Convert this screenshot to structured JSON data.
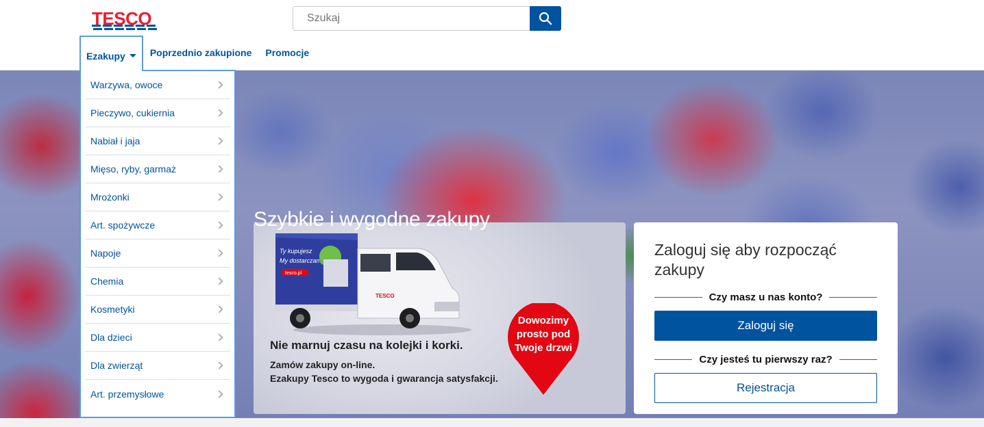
{
  "brand": {
    "name": "TESCO",
    "color": "#ee1c2e",
    "stripe_color": "#00539f"
  },
  "search": {
    "placeholder": "Szukaj",
    "icon": "search-icon"
  },
  "nav": {
    "items": [
      {
        "label": "Ezakupy"
      },
      {
        "label": "Poprzednio zakupione"
      },
      {
        "label": "Promocje"
      }
    ]
  },
  "categories": [
    {
      "label": "Warzywa, owoce"
    },
    {
      "label": "Pieczywo, cukiernia"
    },
    {
      "label": "Nabiał i jaja"
    },
    {
      "label": "Mięso, ryby, garmaż"
    },
    {
      "label": "Mrożonki"
    },
    {
      "label": "Art. spożywcze"
    },
    {
      "label": "Napoje"
    },
    {
      "label": "Chemia"
    },
    {
      "label": "Kosmetyki"
    },
    {
      "label": "Dla dzieci"
    },
    {
      "label": "Dla zwierząt"
    },
    {
      "label": "Art. przemysłowe"
    }
  ],
  "hero": {
    "title": "Szybkie i wygodne zakupy"
  },
  "promo": {
    "truck_text_1": "Ty kupujesz",
    "truck_text_2": "My dostarczamy",
    "truck_badge": "tesco.pl",
    "truck_brand": "TESCO",
    "headline": "Nie marnuj czasu na kolejki i korki.",
    "line1": "Zamów zakupy on-line.",
    "line2": "Ezakupy Tesco to wygoda i gwarancja satysfakcji.",
    "pin_text": "Dowozimy prosto pod Twoje drzwi"
  },
  "login": {
    "title": "Zaloguj się aby rozpocząć zakupy",
    "has_account": "Czy masz u nas konto?",
    "login_button": "Zaloguj się",
    "first_time": "Czy jesteś tu pierwszy raz?",
    "register_button": "Rejestracja"
  },
  "colors": {
    "accent": "#00539f",
    "dropdown_border": "#5a9be0",
    "pin_red": "#e30613"
  }
}
